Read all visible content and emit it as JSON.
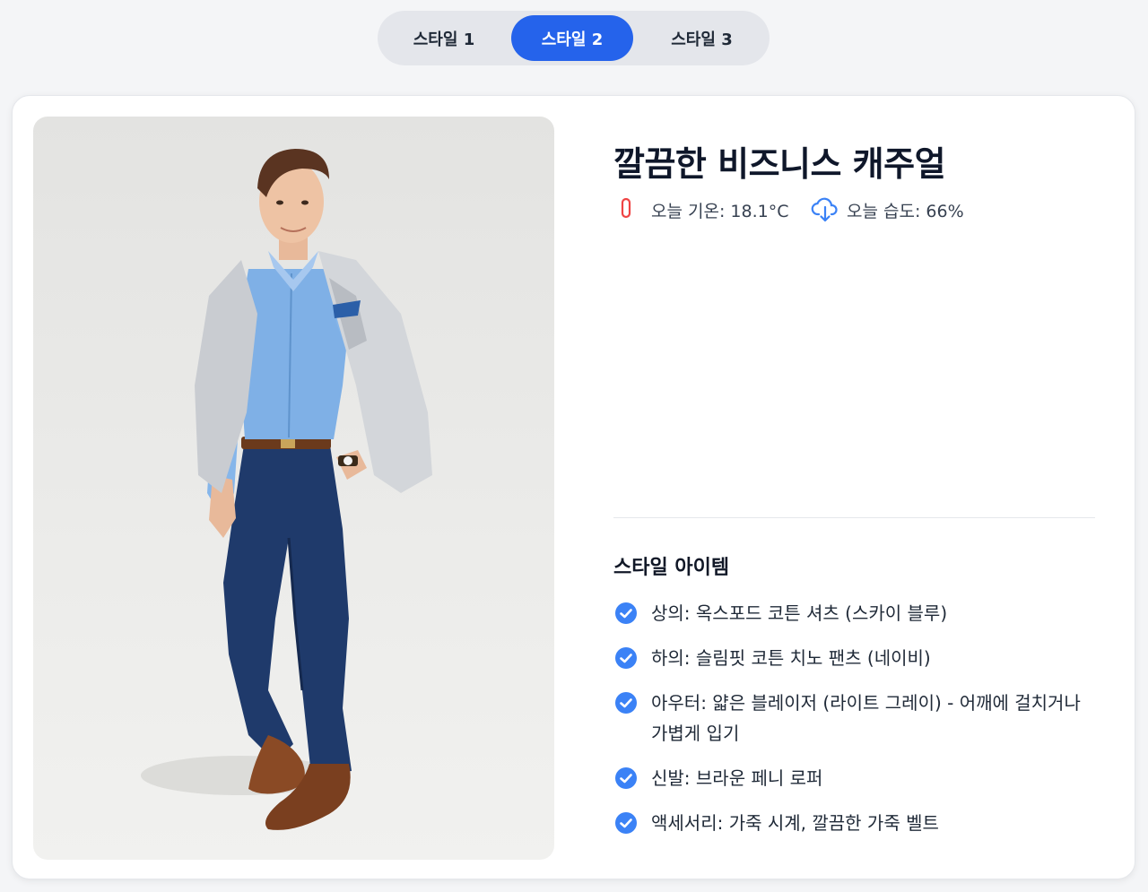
{
  "tabs": [
    {
      "label": "스타일 1",
      "active": false
    },
    {
      "label": "스타일 2",
      "active": true
    },
    {
      "label": "스타일 3",
      "active": false
    }
  ],
  "style": {
    "title": "깔끔한 비즈니스 캐주얼",
    "weather": {
      "temperature_text": "오늘 기온: 18.1°C",
      "humidity_text": "오늘 습도: 66%",
      "temperature_icon": "thermometer-icon",
      "humidity_icon": "cloud-download-icon"
    },
    "items_title": "스타일 아이템",
    "items": [
      "상의: 옥스포드 코튼 셔츠 (스카이 블루)",
      "하의: 슬림핏 코튼 치노 팬츠 (네이비)",
      "아우터: 얇은 블레이저 (라이트 그레이) - 어깨에 걸치거나 가볍게 입기",
      "신발: 브라운 페니 로퍼",
      "액세서리: 가죽 시계, 깔끔한 가죽 벨트"
    ]
  },
  "colors": {
    "accent": "#2563eb",
    "thermometer": "#ef4444",
    "check": "#3b82f6"
  }
}
